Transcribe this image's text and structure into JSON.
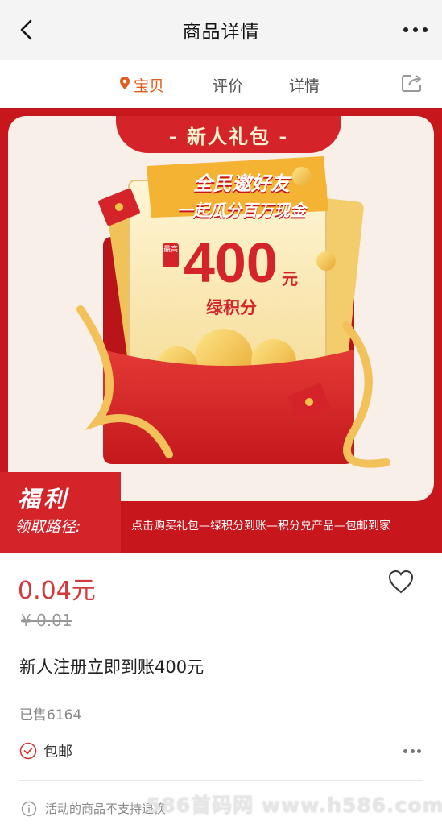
{
  "header": {
    "title": "商品详情"
  },
  "tabs": [
    {
      "label": "宝贝"
    },
    {
      "label": "评价"
    },
    {
      "label": "详情"
    }
  ],
  "banner": {
    "gift_tab": "- 新人礼包 -",
    "headline_1": "全民邀好友",
    "headline_2": "一起瓜分百万现金",
    "max_badge": "最高",
    "amount": "400",
    "amount_unit": "元",
    "points_label": "绿积分",
    "fuli": "福利",
    "path_label": "领取路径:",
    "path_text": "点击购买礼包—绿积分到账—积分兑产品—包邮到家"
  },
  "product": {
    "price": "0.04元",
    "original_price": "¥ 0.01",
    "name": "新人注册立即到账400元",
    "sold": "已售6164",
    "shipping": "包邮",
    "notice": "活动的商品不支持退换"
  },
  "watermark": "586首码网 www.h586.com",
  "colors": {
    "accent": "#e15c1f",
    "price": "#d23a3a",
    "banner_red": "#c8161d"
  },
  "icons": [
    "back-arrow-icon",
    "more-dots-icon",
    "location-pin-icon",
    "share-icon",
    "heart-icon",
    "check-circle-icon",
    "info-icon"
  ]
}
